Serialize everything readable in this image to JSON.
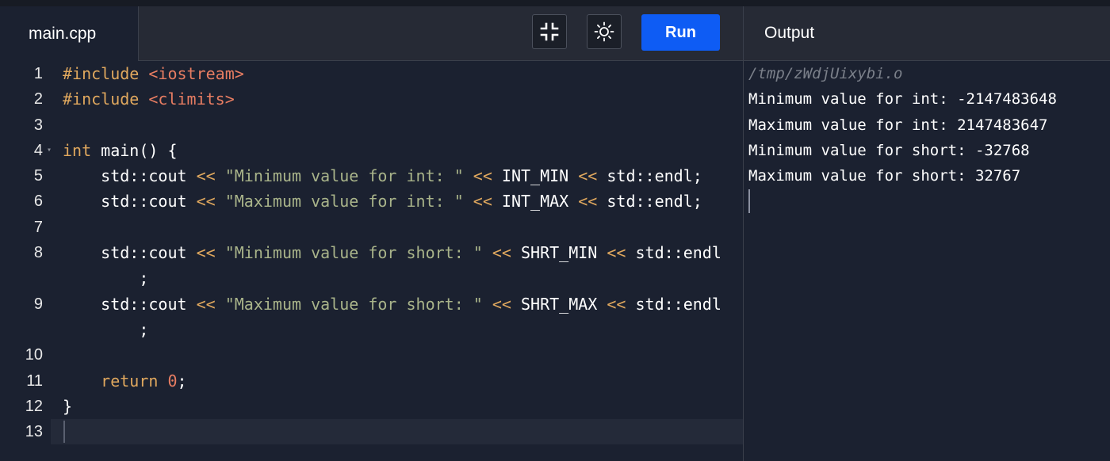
{
  "editor": {
    "file_tab": "main.cpp",
    "lines": [
      {
        "num": "1",
        "segments": [
          {
            "text": "#include ",
            "cls": "kw"
          },
          {
            "text": "<iostream>",
            "cls": "inc"
          }
        ]
      },
      {
        "num": "2",
        "segments": [
          {
            "text": "#include ",
            "cls": "kw"
          },
          {
            "text": "<climits>",
            "cls": "inc"
          }
        ]
      },
      {
        "num": "3",
        "segments": []
      },
      {
        "num": "4",
        "fold": true,
        "segments": [
          {
            "text": "int ",
            "cls": "kw"
          },
          {
            "text": "main() {",
            "cls": "id"
          }
        ]
      },
      {
        "num": "5",
        "segments": [
          {
            "text": "    std::cout ",
            "cls": "id"
          },
          {
            "text": "<< ",
            "cls": "op"
          },
          {
            "text": "\"Minimum value for int: \"",
            "cls": "str"
          },
          {
            "text": " << ",
            "cls": "op"
          },
          {
            "text": "INT_MIN ",
            "cls": "id"
          },
          {
            "text": "<< ",
            "cls": "op"
          },
          {
            "text": "std::endl;",
            "cls": "id"
          }
        ]
      },
      {
        "num": "6",
        "segments": [
          {
            "text": "    std::cout ",
            "cls": "id"
          },
          {
            "text": "<< ",
            "cls": "op"
          },
          {
            "text": "\"Maximum value for int: \"",
            "cls": "str"
          },
          {
            "text": " << ",
            "cls": "op"
          },
          {
            "text": "INT_MAX ",
            "cls": "id"
          },
          {
            "text": "<< ",
            "cls": "op"
          },
          {
            "text": "std::endl;",
            "cls": "id"
          }
        ]
      },
      {
        "num": "7",
        "segments": []
      },
      {
        "num": "8",
        "segments": [
          {
            "text": "    std::cout ",
            "cls": "id"
          },
          {
            "text": "<< ",
            "cls": "op"
          },
          {
            "text": "\"Minimum value for short: \"",
            "cls": "str"
          },
          {
            "text": " << ",
            "cls": "op"
          },
          {
            "text": "SHRT_MIN ",
            "cls": "id"
          },
          {
            "text": "<< ",
            "cls": "op"
          },
          {
            "text": "std::endl",
            "cls": "id"
          }
        ]
      },
      {
        "num": "",
        "segments": [
          {
            "text": "        ;",
            "cls": "id"
          }
        ]
      },
      {
        "num": "9",
        "segments": [
          {
            "text": "    std::cout ",
            "cls": "id"
          },
          {
            "text": "<< ",
            "cls": "op"
          },
          {
            "text": "\"Maximum value for short: \"",
            "cls": "str"
          },
          {
            "text": " << ",
            "cls": "op"
          },
          {
            "text": "SHRT_MAX ",
            "cls": "id"
          },
          {
            "text": "<< ",
            "cls": "op"
          },
          {
            "text": "std::endl",
            "cls": "id"
          }
        ]
      },
      {
        "num": "",
        "segments": [
          {
            "text": "        ;",
            "cls": "id"
          }
        ]
      },
      {
        "num": "10",
        "segments": []
      },
      {
        "num": "11",
        "segments": [
          {
            "text": "    return ",
            "cls": "kw"
          },
          {
            "text": "0",
            "cls": "num"
          },
          {
            "text": ";",
            "cls": "id"
          }
        ]
      },
      {
        "num": "12",
        "segments": [
          {
            "text": "}",
            "cls": "id"
          }
        ]
      },
      {
        "num": "13",
        "segments": []
      }
    ]
  },
  "toolbar": {
    "fullscreen_icon": "collapse-icon",
    "theme_icon": "sun-icon",
    "run_label": "Run"
  },
  "output": {
    "title": "Output",
    "path": "/tmp/zWdjUixybi.o",
    "lines": [
      "Minimum value for int: -2147483648",
      "Maximum value for int: 2147483647",
      "Minimum value for short: -32768",
      "Maximum value for short: 32767"
    ]
  },
  "colors": {
    "run_button": "#0e5cf4",
    "editor_bg": "#1b2130",
    "keyword": "#e0a85e",
    "string": "#a9b48a",
    "include": "#e87d62"
  }
}
